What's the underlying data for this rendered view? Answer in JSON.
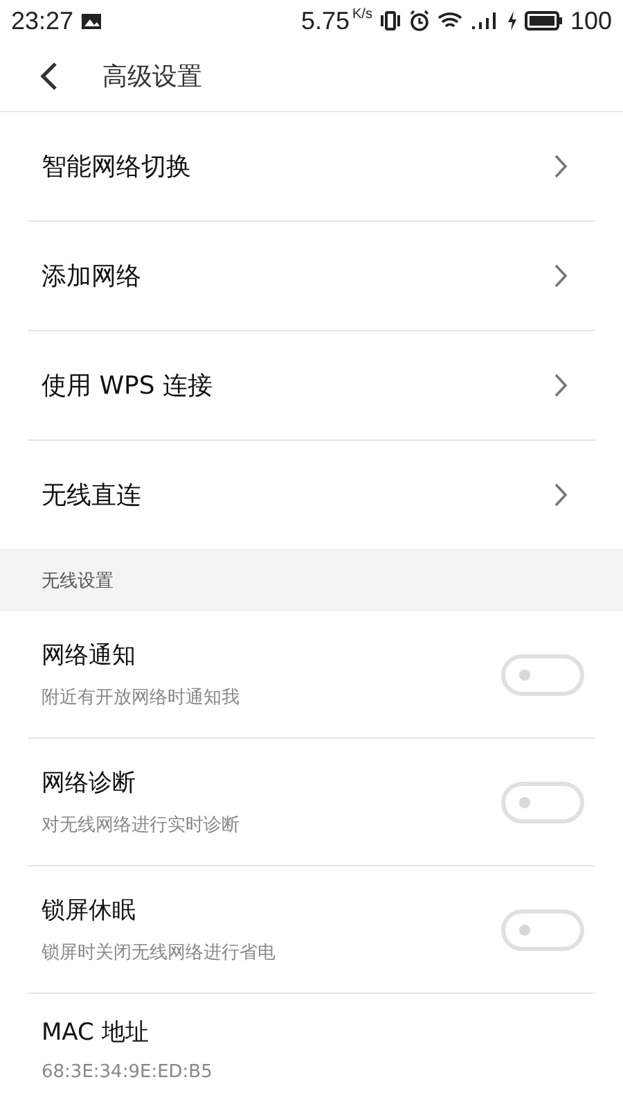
{
  "status_bar": {
    "time": "23:27",
    "speed": "5.75",
    "speed_unit": "K/s",
    "battery": "100"
  },
  "header": {
    "title": "高级设置"
  },
  "nav_items": [
    {
      "label": "智能网络切换"
    },
    {
      "label": "添加网络"
    },
    {
      "label": "使用 WPS 连接"
    },
    {
      "label": "无线直连"
    }
  ],
  "section": {
    "title": "无线设置"
  },
  "settings": [
    {
      "kind": "toggle",
      "title": "网络通知",
      "subtitle": "附近有开放网络时通知我",
      "on": false
    },
    {
      "kind": "toggle",
      "title": "网络诊断",
      "subtitle": "对无线网络进行实时诊断",
      "on": false
    },
    {
      "kind": "toggle",
      "title": "锁屏休眠",
      "subtitle": "锁屏时关闭无线网络进行省电",
      "on": false
    },
    {
      "kind": "info",
      "title": "MAC 地址",
      "subtitle": "68:3E:34:9E:ED:B5"
    }
  ]
}
